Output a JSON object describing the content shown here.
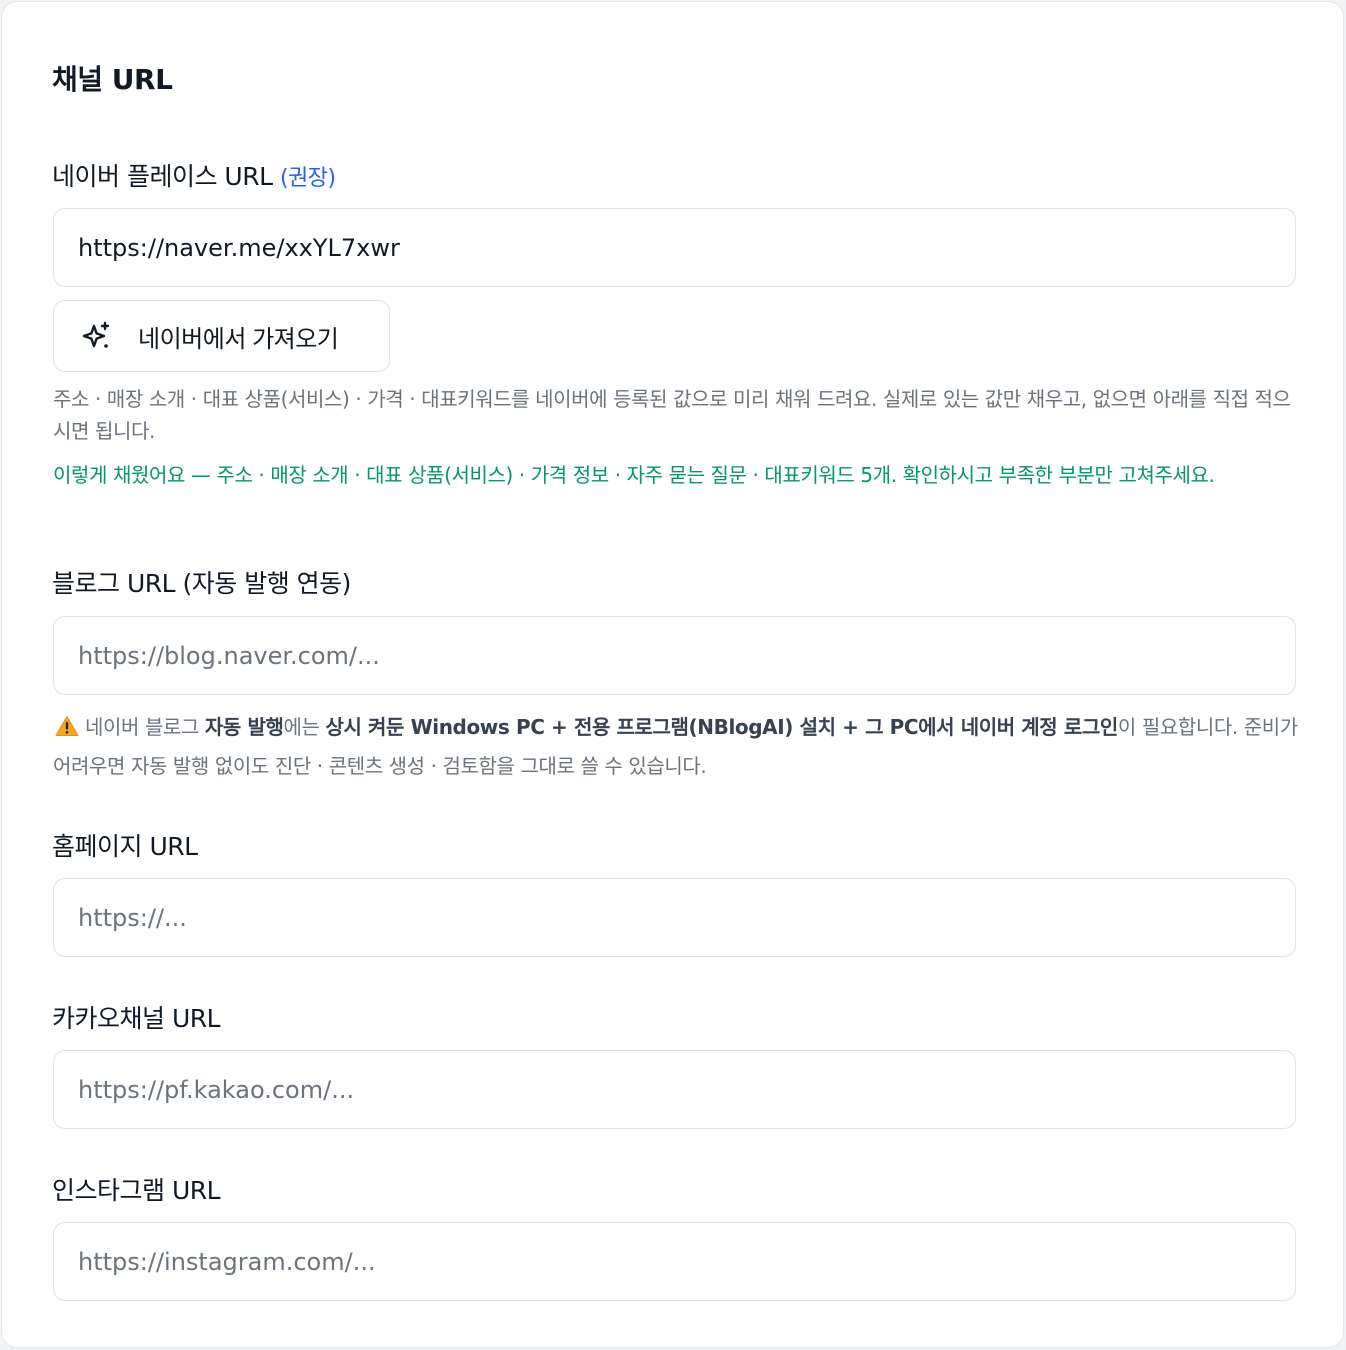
{
  "section": {
    "title": "채널 URL"
  },
  "naver_place": {
    "label": "네이버 플레이스 URL",
    "recommended": "(권장)",
    "value": "https://naver.me/xxYL7xwr",
    "fetch_button": "네이버에서 가져오기",
    "help": "주소 · 매장 소개 · 대표 상품(서비스) · 가격 · 대표키워드를 네이버에 등록된 값으로 미리 채워 드려요. 실제로 있는 값만 채우고, 없으면 아래를 직접 적으시면 됩니다.",
    "success": "이렇게 채웠어요 — 주소 · 매장 소개 · 대표 상품(서비스) · 가격 정보 · 자주 묻는 질문 · 대표키워드 5개. 확인하시고 부족한 부분만 고쳐주세요."
  },
  "blog": {
    "label": "블로그 URL (자동 발행 연동)",
    "placeholder": "https://blog.naver.com/...",
    "warning": {
      "icon": "warning-icon",
      "t1": "네이버 블로그 ",
      "b1": "자동 발행",
      "t2": "에는 ",
      "b2": "상시 켜둔 Windows PC + 전용 프로그램(NBlogAI) 설치 + 그 PC에서 네이버 계정 로그인",
      "t3": "이 필요합니다. 준비가 어려우면 자동 발행 없이도 진단 · 콘텐츠 생성 · 검토함을 그대로 쓸 수 있습니다."
    }
  },
  "homepage": {
    "label": "홈페이지 URL",
    "placeholder": "https://..."
  },
  "kakao": {
    "label": "카카오채널 URL",
    "placeholder": "https://pf.kakao.com/..."
  },
  "instagram": {
    "label": "인스타그램 URL",
    "placeholder": "https://instagram.com/..."
  },
  "colors": {
    "accent": "#2563eb",
    "success": "#059669",
    "warning": "#f59e0b",
    "muted": "#6b7280"
  }
}
